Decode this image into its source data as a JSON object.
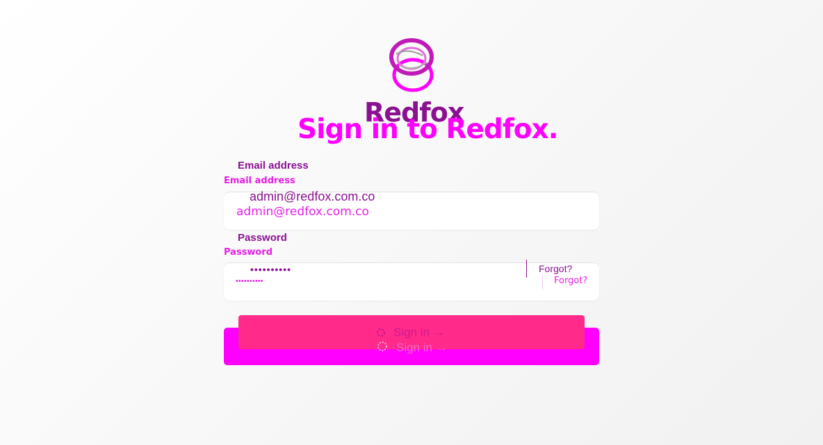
{
  "brand": {
    "name": "Redfox",
    "heading": "Sign in to Redfox."
  },
  "email": {
    "label": "Email address",
    "label_secondary": "Email address",
    "value": "admin@redfox.com.co",
    "value_secondary": "admin@redfox.com.co"
  },
  "password": {
    "label": "Password",
    "label_secondary": "Password",
    "masked": "••••••••••",
    "masked_secondary": "••••••••••",
    "forgot": "Forgot?",
    "forgot_secondary": "Forgot?"
  },
  "submit": {
    "label": "Sign in →",
    "label_secondary": "Sign in →",
    "state": "loading"
  },
  "colors": {
    "brand_purple": "#8a1190",
    "magenta": "#ff00ff",
    "button_pink": "#ff2a8a"
  },
  "icons": [
    "logo-rings-icon",
    "spinner-icon"
  ]
}
